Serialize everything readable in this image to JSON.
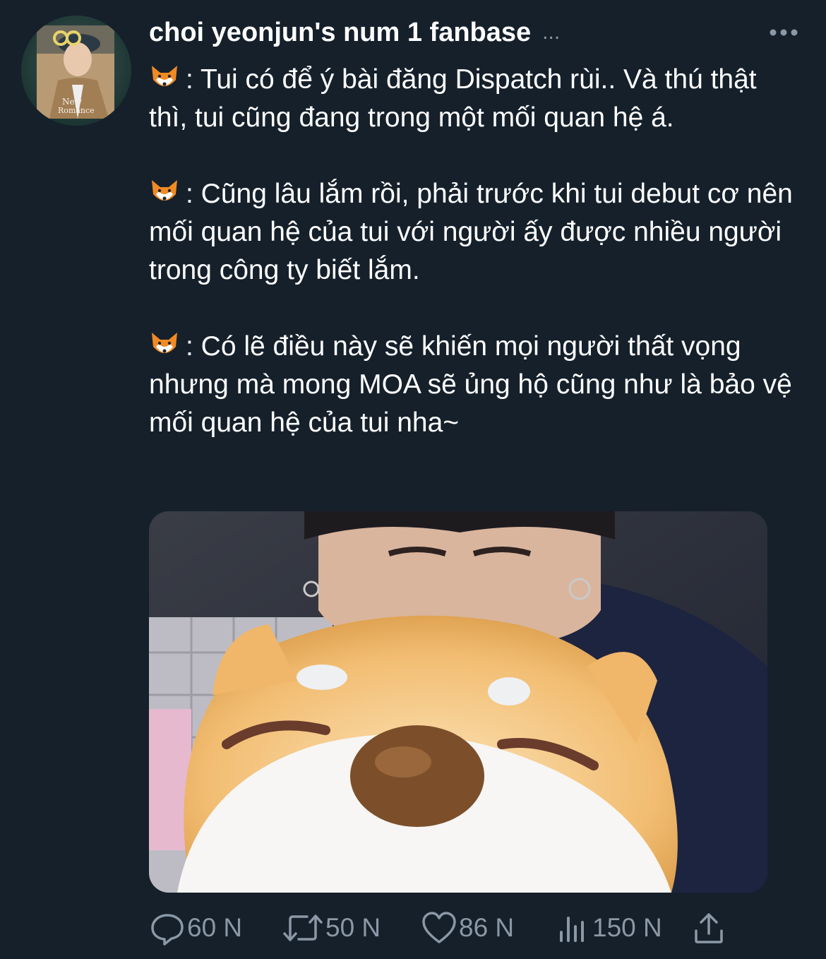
{
  "author": {
    "display_name": "choi yeonjun's num 1 fanbase",
    "name_truncation": "...",
    "avatar_icon": "profile-photo-icon"
  },
  "more_icon": "more-options-icon",
  "body": {
    "paragraphs": [
      ": Tui có để ý bài đăng Dispatch rùi.. Và thú thật thì, tui cũng đang trong một mối quan hệ á.",
      ": Cũng lâu lắm rồi, phải trước khi tui debut cơ nên mối quan hệ của tui với người ấy được nhiều người trong công ty biết lắm.",
      ": Có lẽ điều này sẽ khiến mọi người thất vọng nhưng mà mong MOA sẽ ủng hộ cũng như là bảo vệ mối quan hệ của tui nha~"
    ],
    "emoji_icon": "fox-face-icon"
  },
  "media": {
    "icon": "photo-plush-dog-icon"
  },
  "actions": {
    "replies": "60 N",
    "retweets": "50 N",
    "likes": "86 N",
    "views": "150 N"
  },
  "colors": {
    "background": "#15202b",
    "text": "#ffffff",
    "secondary": "#8b98a5"
  }
}
